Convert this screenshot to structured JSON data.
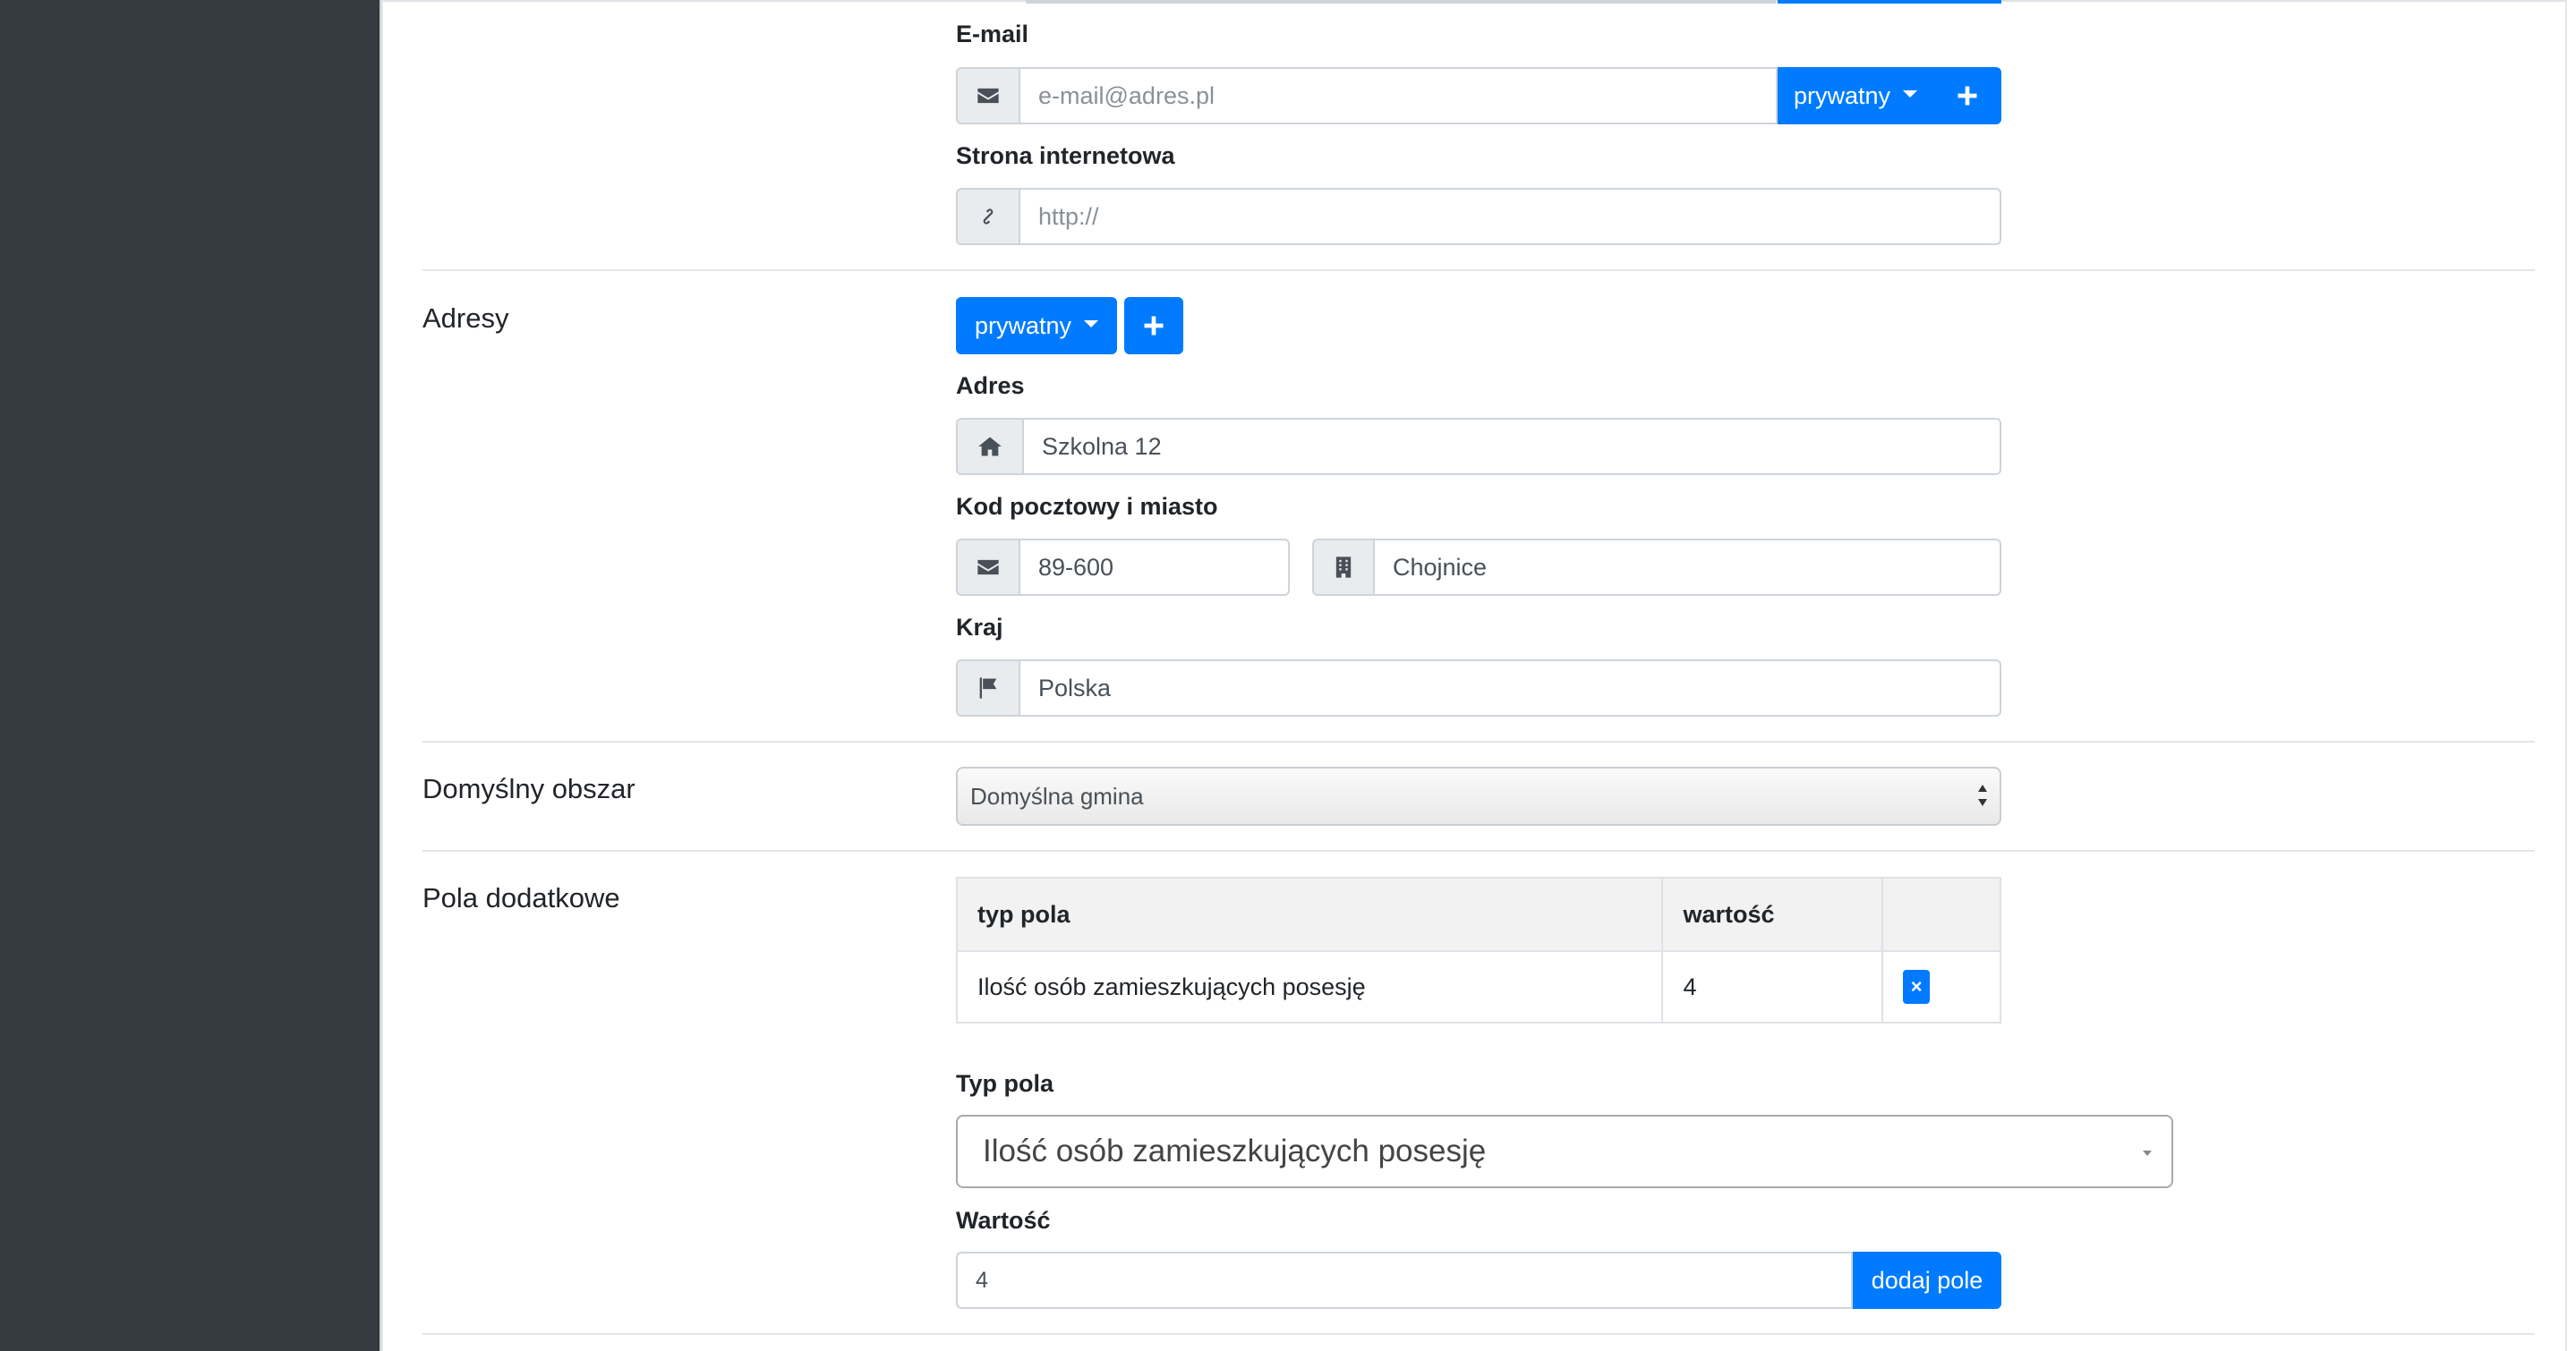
{
  "colors": {
    "sidebar": "#343a40",
    "primary": "#007bff",
    "addon_bg": "#e9ecef",
    "border": "#ced4da"
  },
  "contact": {
    "email": {
      "label": "E-mail",
      "placeholder": "e-mail@adres.pl",
      "icon": "envelope-icon",
      "type_button": "prywatny",
      "add_icon": "plus-icon"
    },
    "website": {
      "label": "Strona internetowa",
      "placeholder": "http://",
      "icon": "link-icon"
    }
  },
  "addresses": {
    "section_title": "Adresy",
    "type_button": "prywatny",
    "add_icon": "plus-icon",
    "address": {
      "label": "Adres",
      "value": "Szkolna 12",
      "icon": "home-icon"
    },
    "postal_city": {
      "label": "Kod pocztowy i miasto",
      "postal_code": "89-600",
      "postal_icon": "envelope-icon",
      "city": "Chojnice",
      "city_icon": "building-icon"
    },
    "country": {
      "label": "Kraj",
      "value": "Polska",
      "icon": "flag-icon"
    }
  },
  "default_area": {
    "section_title": "Domyślny obszar",
    "selected": "Domyślna gmina"
  },
  "extra_fields": {
    "section_title": "Pola dodatkowe",
    "columns": [
      "typ pola",
      "wartość",
      ""
    ],
    "rows": [
      {
        "type": "Ilość osób zamieszkujących posesję",
        "value": "4",
        "delete_label": "×"
      }
    ],
    "field_type_label": "Typ pola",
    "field_type_selected": "Ilość osób zamieszkujących posesję",
    "value_label": "Wartość",
    "value_input": "4",
    "add_button": "dodaj pole"
  }
}
